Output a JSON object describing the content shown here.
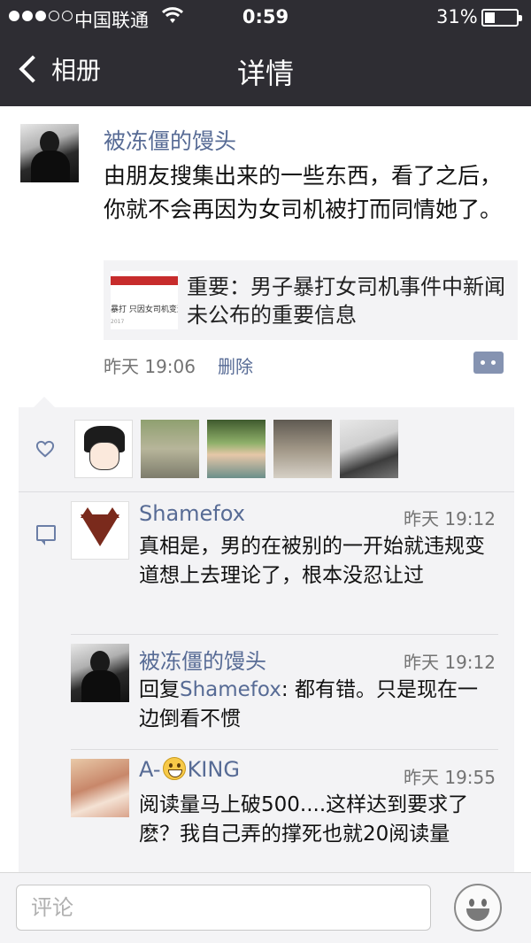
{
  "status_bar": {
    "carrier": "中国联通",
    "time": "0:59",
    "battery": "31%",
    "battery_level": 0.31,
    "signal_bars": 3,
    "signal_max": 5
  },
  "nav": {
    "back_label": "相册",
    "title": "详情"
  },
  "post": {
    "author": "被冻僵的馒头",
    "text": "由朋友搜集出来的一些东西，看了之后，你就不会再因为女司机被打而同情她了。",
    "link_card": {
      "title": "重要：男子暴打女司机事件中新闻未公布的重要信息",
      "thumb_text": "暴打 只因女司机变道",
      "thumb_year": "2017"
    },
    "time": "昨天 19:06",
    "delete_label": "删除"
  },
  "comments": [
    {
      "name": "Shamefox",
      "time": "昨天 19:12",
      "text": "真相是，男的在被别的一开始就违规变道想上去理论了，根本没忍让过"
    },
    {
      "name": "被冻僵的馒头",
      "time": "昨天 19:12",
      "reply_prefix": "回复",
      "reply_to": "Shamefox",
      "text": ": 都有错。只是现在一边倒看不惯"
    },
    {
      "name_prefix": "A-",
      "name_suffix": "KING",
      "time": "昨天 19:55",
      "text": "阅读量马上破500....这样达到要求了麽？我自己弄的撑死也就20阅读量"
    }
  ],
  "input": {
    "placeholder": "评论"
  },
  "colors": {
    "nav_bg": "#2e2d33",
    "link_blue": "#576b95",
    "panel_bg": "#f3f3f5"
  },
  "icons": [
    "back-chevron-icon",
    "wifi-icon",
    "battery-icon",
    "heart-icon",
    "comment-icon",
    "more-icon",
    "emoji-icon"
  ]
}
